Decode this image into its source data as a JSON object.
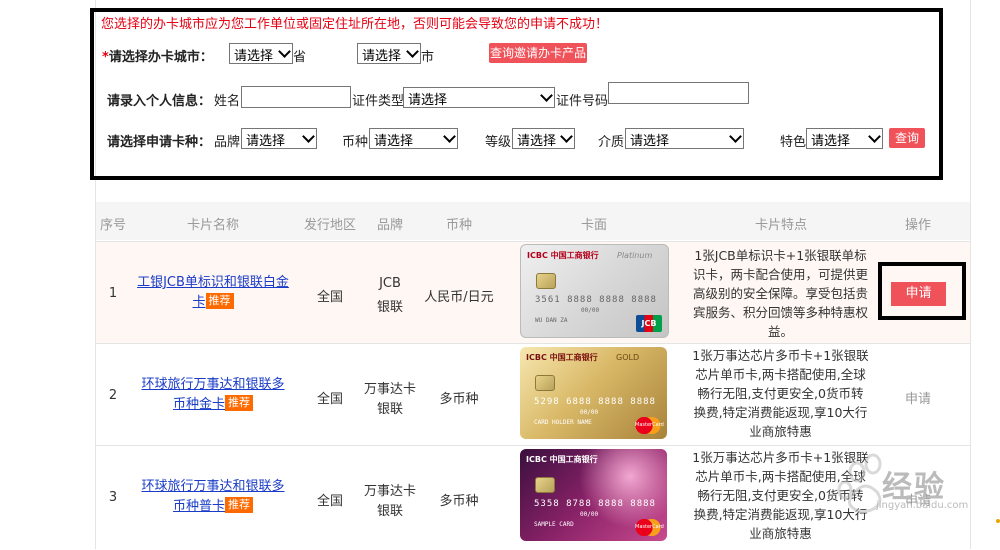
{
  "form": {
    "warning": "您选择的办卡城市应为您工作单位或固定住址所在地，否则可能会导致您的申请不成功！",
    "city_row": {
      "required_mark": "*",
      "label": "请选择办卡城市：",
      "province_select": "请选择",
      "province_suffix": "省",
      "city_select": "请选择",
      "city_suffix": "市",
      "query_button": "查询邀请办卡产品"
    },
    "personal_row": {
      "label": "请录入个人信息：",
      "name_label": "姓名",
      "name_value": "",
      "id_type_label": "证件类型",
      "id_type_select": "请选择",
      "id_number_label": "证件号码",
      "id_number_value": ""
    },
    "card_type_row": {
      "label": "请选择申请卡种：",
      "brand_label": "品牌",
      "brand_select": "请选择",
      "currency_label": "币种",
      "currency_select": "请选择",
      "grade_label": "等级",
      "grade_select": "请选择",
      "medium_label": "介质",
      "medium_select": "请选择",
      "feature_label": "特色",
      "feature_select": "请选择",
      "query_button": "查询"
    }
  },
  "table": {
    "headers": [
      "序号",
      "卡片名称",
      "发行地区",
      "品牌",
      "币种",
      "卡面",
      "卡片特点",
      "操作"
    ],
    "rows": [
      {
        "index": "1",
        "name_line1": "工银JCB单标识和银联白金",
        "name_line2": "卡",
        "tag": "推荐",
        "region": "全国",
        "brand_line1": "JCB",
        "brand_line2": "银联",
        "currency": "人民币/日元",
        "card": {
          "bank": "ICBC 中国工商银行",
          "tier": "Platinum",
          "number": "3561 8888 8888 8888",
          "date": "00/00",
          "holder": "WU DAN ZA",
          "logo": "JCB"
        },
        "features": [
          "1张JCB单标识卡+1张银联单标",
          "识卡，两卡配合使用，可提供更",
          "高级别的安全保障。享受包括贵",
          "宾服务、积分回馈等多种特惠权",
          "益。"
        ],
        "action": "申请"
      },
      {
        "index": "2",
        "name_line1": "环球旅行万事达和银联多",
        "name_line2": "币种金卡",
        "tag": "推荐",
        "region": "全国",
        "brand_line1": "万事达卡",
        "brand_line2": "银联",
        "currency": "多币种",
        "card": {
          "bank": "ICBC 中国工商银行",
          "tier": "GOLD",
          "number": "5298 6888 8888 8888",
          "date": "00/00",
          "holder": "CARD HOLDER NAME",
          "logo": "MasterCard"
        },
        "features": [
          "1张万事达芯片多币卡+1张银联",
          "芯片单币卡,两卡搭配使用,全球",
          "畅行无阻,支付更安全,0货币转",
          "换费,特定消费能返现,享10大行",
          "业商旅特惠"
        ],
        "action": "申请"
      },
      {
        "index": "3",
        "name_line1": "环球旅行万事达和银联多",
        "name_line2": "币种普卡",
        "tag": "推荐",
        "region": "全国",
        "brand_line1": "万事达卡",
        "brand_line2": "银联",
        "currency": "多币种",
        "card": {
          "bank": "ICBC 中国工商银行",
          "tier": "",
          "number": "5358 8788 8888 8888",
          "date": "00/00",
          "holder": "SAMPLE CARD",
          "logo": "MasterCard"
        },
        "features": [
          "1张万事达芯片多币卡+1张银联",
          "芯片单币卡,两卡搭配使用,全球",
          "畅行无阻,支付更安全,0货币转",
          "换费,特定消费能返现,享10大行",
          "业商旅特惠"
        ],
        "action": "申请"
      }
    ]
  },
  "watermark": {
    "text": "经验",
    "url": "jingyan.baidu.com"
  },
  "colors": {
    "accent_red": "#f0525a",
    "warning_red": "#e60012",
    "link_blue": "#1a3cc8",
    "tag_orange": "#ff6a00"
  }
}
